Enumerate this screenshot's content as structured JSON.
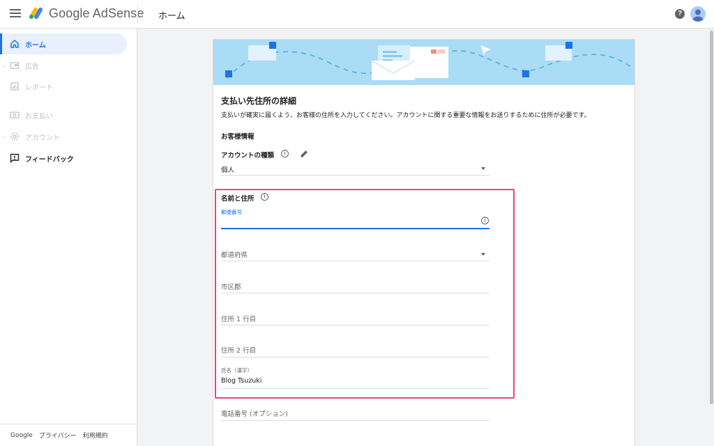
{
  "header": {
    "app_name": "Google AdSense",
    "page_title": "ホーム",
    "help_symbol": "?"
  },
  "sidebar": {
    "items": [
      {
        "label": "ホーム",
        "state": "active",
        "icon": "home-icon"
      },
      {
        "label": "広告",
        "state": "disabled",
        "icon": "ads-icon"
      },
      {
        "label": "レポート",
        "state": "disabled",
        "icon": "report-icon"
      },
      {
        "label": "お支払い",
        "state": "disabled",
        "icon": "payment-icon"
      },
      {
        "label": "アカウント",
        "state": "disabled",
        "icon": "gear-icon"
      },
      {
        "label": "フィードバック",
        "state": "normal",
        "icon": "feedback-icon"
      }
    ],
    "footer": [
      "Google",
      "プライバシー",
      "利用規約"
    ]
  },
  "form": {
    "title": "支払い先住所の詳細",
    "description": "支払いが確実に届くよう、お客様の住所を入力してください。アカウントに関する重要な情報をお送りするために住所が必要です。",
    "customer_info_heading": "お客様情報",
    "account_type_label": "アカウントの種類",
    "account_type_value": "個人",
    "name_address_heading": "名前と住所",
    "postal_code_label": "郵便番号",
    "postal_code_value": "",
    "prefecture_placeholder": "都道府県",
    "city_placeholder": "市区郡",
    "address1_placeholder": "住所 1 行目",
    "address2_placeholder": "住所 2 行目",
    "name_label": "氏名（漢字）",
    "name_value": "Blog Tsuzuki",
    "phone_placeholder": "電話番号 (オプション)",
    "info_symbol": "i"
  },
  "colors": {
    "accent": "#1a73e8",
    "active_nav_bg": "#e8f0fe",
    "highlight": "#e8457e",
    "banner": "#aadcf5"
  }
}
